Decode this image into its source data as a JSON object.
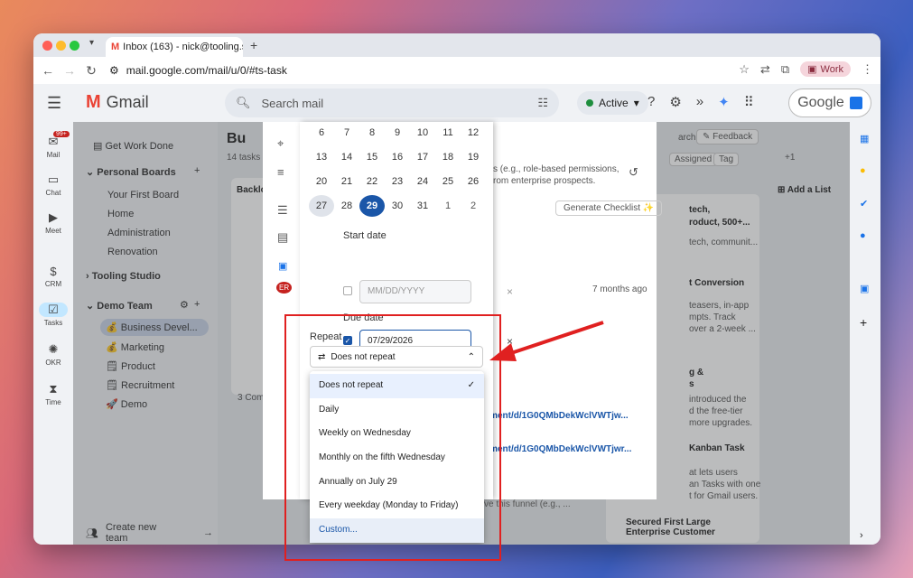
{
  "browser": {
    "tab_title": "Inbox (163) - nick@tooling.st",
    "url": "mail.google.com/mail/u/0/#ts-task",
    "profile_label": "Work"
  },
  "gmail": {
    "logo_text": "Gmail",
    "search_placeholder": "Search mail",
    "status": "Active",
    "google_label": "Google"
  },
  "rail": [
    {
      "label": "Mail",
      "badge": "99+"
    },
    {
      "label": "Chat"
    },
    {
      "label": "Meet"
    },
    {
      "label": "CRM"
    },
    {
      "label": "Tasks"
    },
    {
      "label": "OKR"
    },
    {
      "label": "Time"
    }
  ],
  "sidebar": {
    "get_work_done": "Get Work Done",
    "personal_boards": "Personal Boards",
    "personal_items": [
      "Your First Board",
      "Home",
      "Administration",
      "Renovation"
    ],
    "tooling_studio": "Tooling Studio",
    "demo_team": "Demo Team",
    "team_items": [
      "💰 Business Devel...",
      "💰 Marketing",
      "🗒 Product",
      "🗒 Recruitment",
      "🚀 Demo"
    ],
    "create_team": "Create new team"
  },
  "background": {
    "board_title": "Bu",
    "tasks_count": "14 tasks",
    "backlog": "Backlo",
    "search_partial": "arch",
    "feedback": "Feedback",
    "assigned": "Assigned",
    "tag": "Tag",
    "plus_count": "+1",
    "add_list": "Add a List",
    "generate_checklist": "Generate Checklist",
    "months_ago": "7 months ago",
    "desc_line1": "s (e.g., role-based permissions,",
    "desc_line2": "rom enterprise prospects.",
    "link1": "ument/d/1G0QMbDekWclVWTjw...",
    "link2": "ument/d/1G0QMbDekWclVWTjwr...",
    "comments": "3 Com",
    "card_lines": [
      "tech,",
      "roduct, 500+...",
      "tech, communit...",
      "t Conversion",
      "teasers, in-app",
      "mpts. Track",
      "over a 2-week ...",
      "g &",
      "s",
      "introduced the",
      "d the free-tier",
      "more upgrades.",
      "Kanban Task",
      "at lets users",
      "an Tasks with one",
      "t for Gmail users."
    ],
    "enterprise_card": "Secured First Large Enterprise Customer",
    "funnel_text": "ve this funnel (e.g., ..."
  },
  "calendar": {
    "weeks": [
      [
        "6",
        "7",
        "8",
        "9",
        "10",
        "11",
        "12"
      ],
      [
        "13",
        "14",
        "15",
        "16",
        "17",
        "18",
        "19"
      ],
      [
        "20",
        "21",
        "22",
        "23",
        "24",
        "25",
        "26"
      ],
      [
        "27",
        "28",
        "29",
        "30",
        "31",
        "1",
        "2"
      ]
    ],
    "selected_day": "29",
    "start_date_label": "Start date",
    "start_date_placeholder": "MM/DD/YYYY",
    "due_date_label": "Due date",
    "due_date_value": "07/29/2026"
  },
  "repeat": {
    "label": "Repeat",
    "selected": "Does not repeat",
    "options": [
      "Does not repeat",
      "Daily",
      "Weekly on Wednesday",
      "Monthly on the fifth Wednesday",
      "Annually on July 29",
      "Every weekday (Monday to Friday)",
      "Custom..."
    ]
  },
  "colors": {
    "accent": "#1a56a8",
    "annotation_red": "#e02020",
    "gmail_red": "#ea4335"
  }
}
